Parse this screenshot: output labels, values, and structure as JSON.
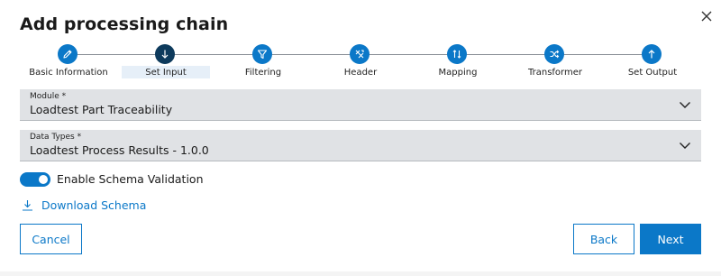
{
  "dialog": {
    "title": "Add processing chain"
  },
  "stepper": {
    "steps": [
      {
        "label": "Basic Information",
        "icon": "pencil-icon",
        "state": "done"
      },
      {
        "label": "Set Input",
        "icon": "arrow-down-icon",
        "state": "active"
      },
      {
        "label": "Filtering",
        "icon": "filter-icon",
        "state": "pending"
      },
      {
        "label": "Header",
        "icon": "header-icon",
        "state": "pending"
      },
      {
        "label": "Mapping",
        "icon": "mapping-icon",
        "state": "pending"
      },
      {
        "label": "Transformer",
        "icon": "shuffle-icon",
        "state": "pending"
      },
      {
        "label": "Set Output",
        "icon": "arrow-up-icon",
        "state": "pending"
      }
    ]
  },
  "module_field": {
    "label": "Module *",
    "value": "Loadtest Part Traceability"
  },
  "data_types_field": {
    "label": "Data Types *",
    "value": "Loadtest Process Results - 1.0.0"
  },
  "schema_toggle": {
    "label": "Enable Schema Validation",
    "enabled": true
  },
  "download": {
    "label": "Download Schema"
  },
  "buttons": {
    "cancel": "Cancel",
    "back": "Back",
    "next": "Next"
  },
  "colors": {
    "accent": "#0b78c8",
    "active_step": "#0d3a5c",
    "field_bg": "#e0e2e5"
  }
}
